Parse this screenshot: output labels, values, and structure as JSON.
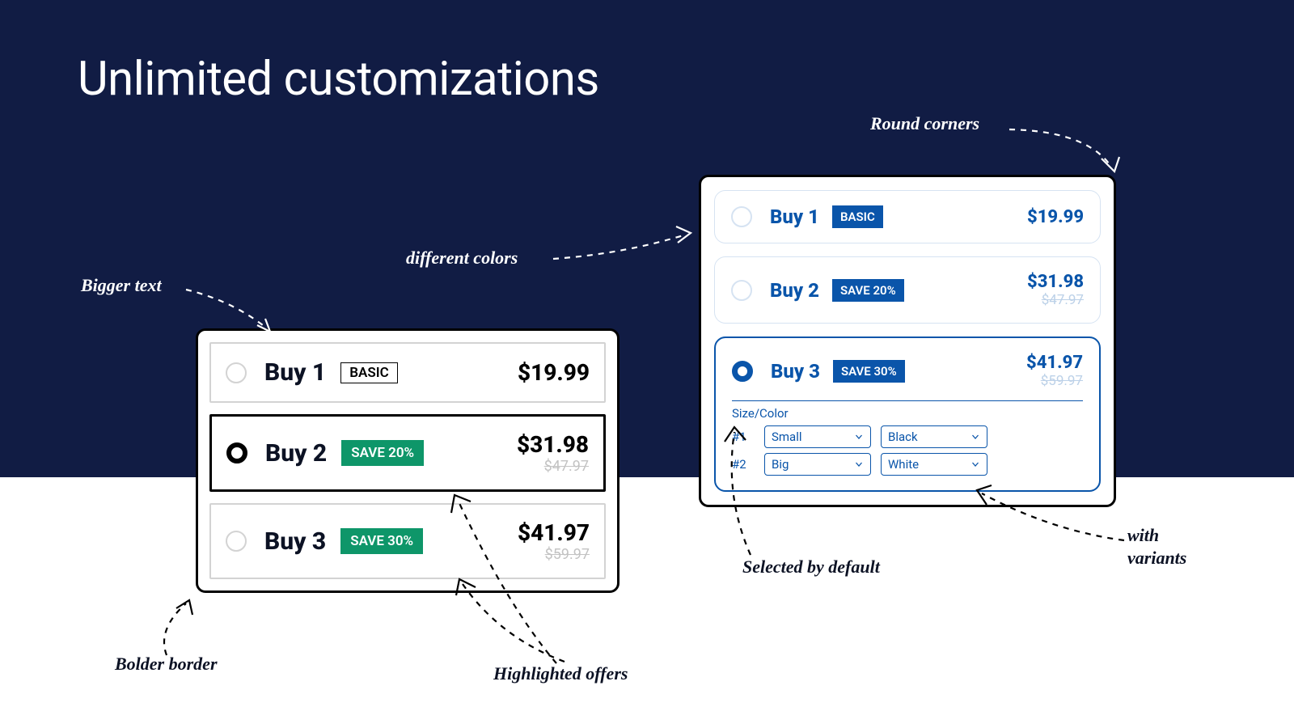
{
  "title": "Unlimited customizations",
  "annotations": {
    "bigger_text": "Bigger text",
    "different_colors": "different colors",
    "round_corners": "Round corners",
    "bolder_border": "Bolder border",
    "highlighted_offers": "Highlighted offers",
    "selected_by_default": "Selected by default",
    "with_variants": "with\nvariants"
  },
  "left_card": {
    "rows": [
      {
        "label": "Buy 1",
        "tag": "BASIC",
        "tag_type": "basic",
        "price": "$19.99",
        "strike": "",
        "selected": false
      },
      {
        "label": "Buy 2",
        "tag": "SAVE 20%",
        "tag_type": "save",
        "price": "$31.98",
        "strike": "$47.97",
        "selected": true
      },
      {
        "label": "Buy 3",
        "tag": "SAVE 30%",
        "tag_type": "save",
        "price": "$41.97",
        "strike": "$59.97",
        "selected": false
      }
    ]
  },
  "right_card": {
    "rows": [
      {
        "label": "Buy 1",
        "tag": "BASIC",
        "price": "$19.99",
        "strike": "",
        "selected": false
      },
      {
        "label": "Buy 2",
        "tag": "SAVE 20%",
        "price": "$31.98",
        "strike": "$47.97",
        "selected": false
      },
      {
        "label": "Buy 3",
        "tag": "SAVE 30%",
        "price": "$41.97",
        "strike": "$59.97",
        "selected": true
      }
    ],
    "variants": {
      "title": "Size/Color",
      "rows": [
        {
          "idx": "#1",
          "opt1": "Small",
          "opt2": "Black"
        },
        {
          "idx": "#2",
          "opt1": "Big",
          "opt2": "White"
        }
      ]
    }
  }
}
